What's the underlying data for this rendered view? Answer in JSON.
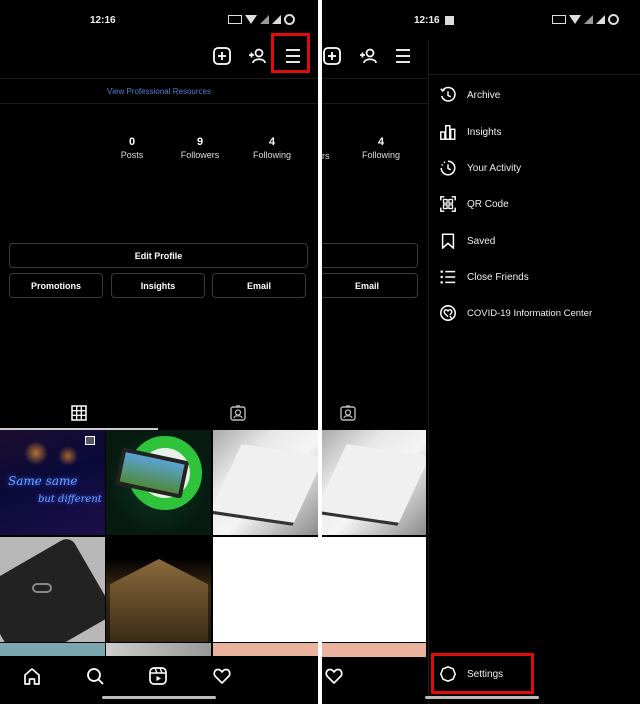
{
  "status_bar": {
    "time": "12:16",
    "icons": [
      "sim-icon",
      "wifi-icon",
      "signal-icon",
      "signal-icon",
      "battery-icon"
    ]
  },
  "left_screen": {
    "header_icons": [
      "new-post-icon",
      "discover-people-icon",
      "menu-icon"
    ],
    "pro_link": "View Professional Resources",
    "stats": [
      {
        "value": "0",
        "label": "Posts"
      },
      {
        "value": "9",
        "label": "Followers"
      },
      {
        "value": "4",
        "label": "Following"
      }
    ],
    "buttons": {
      "edit_profile": "Edit Profile",
      "promotions": "Promotions",
      "insights": "Insights",
      "email": "Email"
    },
    "tabs": [
      "grid-tab",
      "tagged-tab"
    ],
    "grid_posts": [
      {
        "desc": "neon sign 'Same same but different'",
        "overlay_text_1": "Same same",
        "overlay_text_2": "but different"
      },
      {
        "desc": "gaming phone with green ring"
      },
      {
        "desc": "white laptop"
      },
      {
        "desc": "black phone back"
      },
      {
        "desc": "building at night"
      },
      {
        "desc": "white image"
      }
    ],
    "bottom_nav": [
      "home-icon",
      "search-icon",
      "reels-icon",
      "heart-icon"
    ],
    "highlight_color": "#e10b0b"
  },
  "right_screen": {
    "stats_partial": {
      "value": "4",
      "label": "Following",
      "cut_label": "rs"
    },
    "email_button": "Email",
    "drawer": {
      "items": [
        {
          "icon": "archive-icon",
          "label": "Archive"
        },
        {
          "icon": "insights-icon",
          "label": "Insights"
        },
        {
          "icon": "activity-icon",
          "label": "Your Activity"
        },
        {
          "icon": "qr-code-icon",
          "label": "QR Code"
        },
        {
          "icon": "saved-icon",
          "label": "Saved"
        },
        {
          "icon": "close-friends-icon",
          "label": "Close Friends"
        },
        {
          "icon": "covid-info-icon",
          "label": "COVID-19 Information Center"
        }
      ],
      "settings": {
        "icon": "settings-icon",
        "label": "Settings"
      }
    }
  }
}
